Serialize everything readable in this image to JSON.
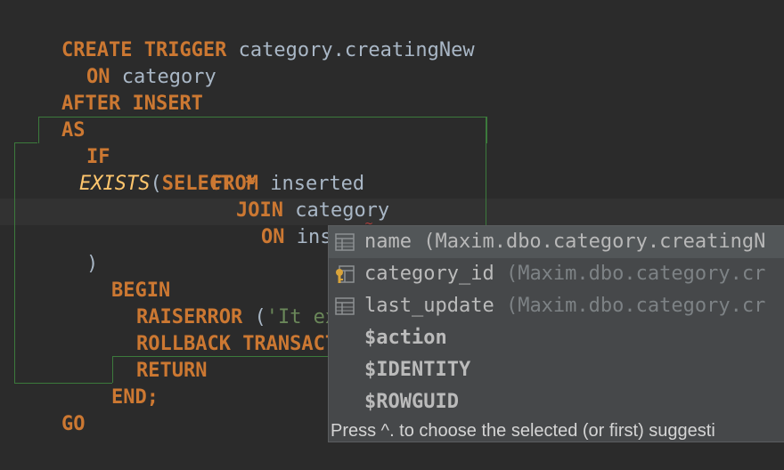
{
  "editor": {
    "lines": [
      {
        "kw1": "CREATE TRIGGER",
        "rest": " category.creatingNew"
      },
      {
        "kw1": "ON",
        "rest": " category"
      },
      {
        "kw1": "AFTER INSERT"
      },
      {
        "kw1": "AS"
      },
      {
        "kw1": "IF",
        "fn": "EXISTS",
        "paren": "(",
        "kw2": "SELECT",
        "rest": " *"
      },
      {
        "kw1": "FROM",
        "rest": " inserted"
      },
      {
        "kw1": "JOIN",
        "rest": " category"
      },
      {
        "kw1": "ON",
        "rest": " inserted."
      },
      {
        "rest": ")"
      },
      {
        "kw1": "BEGIN"
      },
      {
        "kw1": "RAISERROR",
        "rest": " (",
        "str": "'It exis"
      },
      {
        "kw1": "ROLLBACK TRANSACTIO"
      },
      {
        "kw1": "RETURN"
      },
      {
        "kw1": "END",
        "rest": ";"
      },
      {
        "kw1": "GO"
      }
    ],
    "error_mark": "~"
  },
  "completion": {
    "items": [
      {
        "name": "name",
        "detail": "  (Maxim.dbo.category.creatingN",
        "icon": "table-column-icon",
        "selected": true
      },
      {
        "name": "category_id",
        "detail": "  (Maxim.dbo.category.cr",
        "icon": "key-column-icon",
        "selected": false
      },
      {
        "name": "last_update",
        "detail": "  (Maxim.dbo.category.cr",
        "icon": "table-column-icon",
        "selected": false
      },
      {
        "name": "$action",
        "detail": "",
        "icon": "",
        "selected": false
      },
      {
        "name": "$IDENTITY",
        "detail": "",
        "icon": "",
        "selected": false
      },
      {
        "name": "$ROWGUID",
        "detail": "",
        "icon": "",
        "selected": false
      }
    ],
    "footer": "Press ^. to choose the selected (or first) suggesti"
  },
  "colors": {
    "background": "#2b2b2b",
    "keyword": "#cc7832",
    "function": "#ffc66d",
    "identifier": "#a9b7c6",
    "string": "#6a8759",
    "popup_bg": "#46484a",
    "popup_selected": "#525658",
    "block_outline": "#3c7a3c"
  }
}
